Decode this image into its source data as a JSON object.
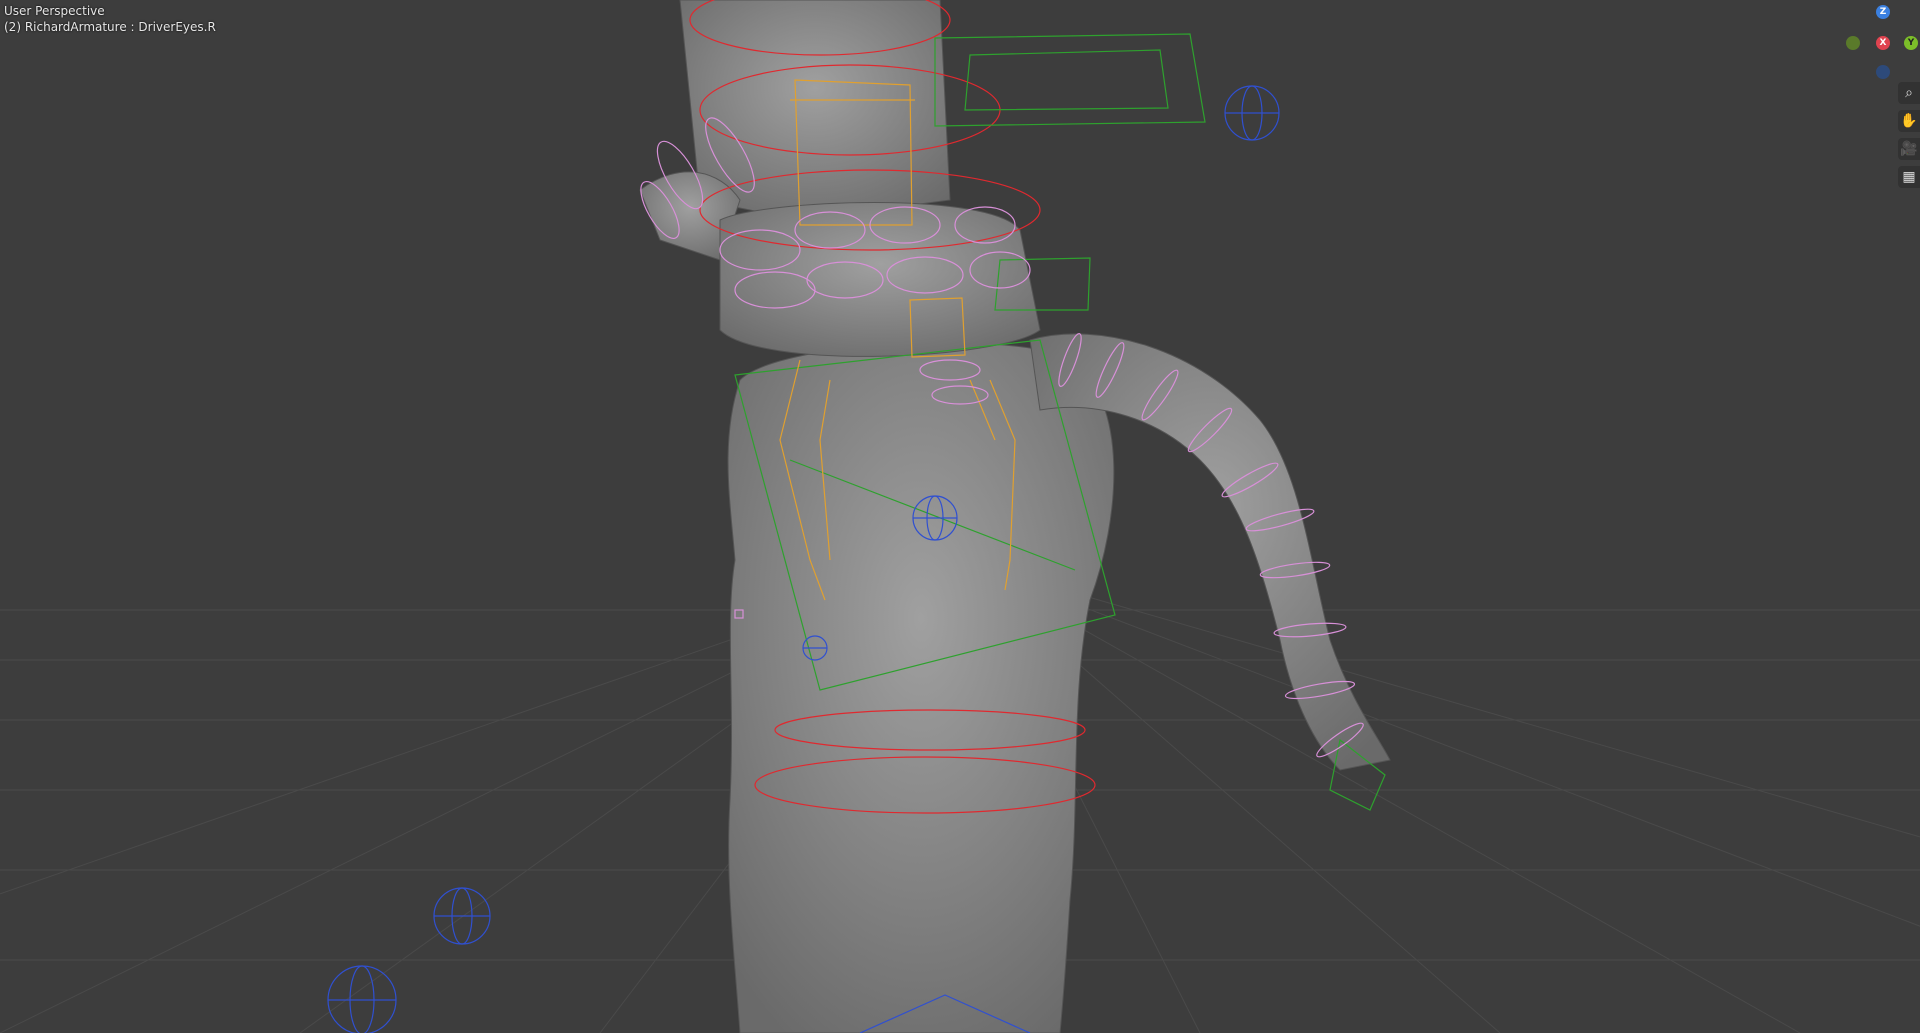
{
  "viewport": {
    "view_label": "User Perspective",
    "object_label": "(2) RichardArmature : DriverEyes.R"
  },
  "gizmo": {
    "axis_z": "Z",
    "axis_x": "X",
    "axis_y": "Y"
  },
  "colors": {
    "background": "#3d3d3d",
    "grid": "#4a4a4a",
    "mesh": "#8a8a8a",
    "bone_red": "#e0292f",
    "bone_green": "#2ea12e",
    "bone_yellow": "#e0a030",
    "bone_pink": "#d890d8",
    "bone_blue": "#3050d0",
    "axis_x": "#e0434f",
    "axis_y": "#7cbf29",
    "axis_z": "#3b80e0"
  },
  "nav_buttons": [
    {
      "name": "zoom-icon",
      "glyph": "⌕"
    },
    {
      "name": "pan-hand-icon",
      "glyph": "✋"
    },
    {
      "name": "camera-icon",
      "glyph": "🎥"
    },
    {
      "name": "grid-icon",
      "glyph": "▦"
    }
  ]
}
